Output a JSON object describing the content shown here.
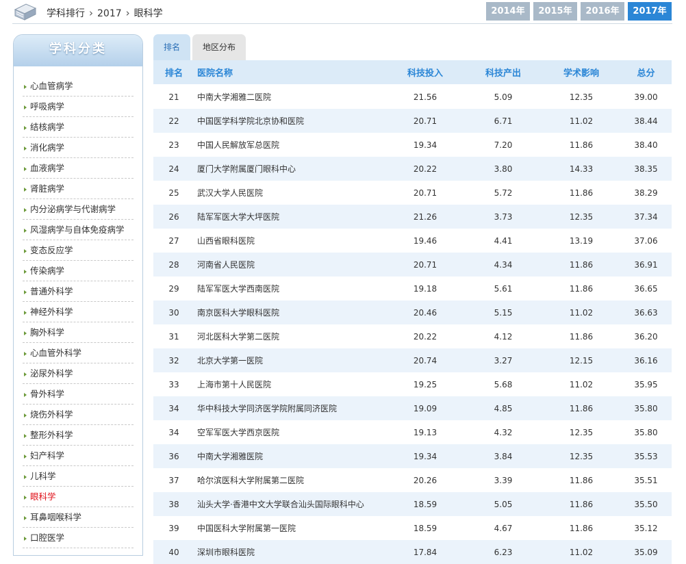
{
  "header": {
    "breadcrumb": [
      "学科排行",
      "2017",
      "眼科学"
    ],
    "years": [
      "2014年",
      "2015年",
      "2016年",
      "2017年"
    ],
    "active_year": "2017年"
  },
  "sidebar": {
    "title": "学科分类",
    "items": [
      "心血管病学",
      "呼吸病学",
      "结核病学",
      "消化病学",
      "血液病学",
      "肾脏病学",
      "内分泌病学与代谢病学",
      "风湿病学与自体免疫病学",
      "变态反应学",
      "传染病学",
      "普通外科学",
      "神经外科学",
      "胸外科学",
      "心血管外科学",
      "泌尿外科学",
      "骨外科学",
      "烧伤外科学",
      "整形外科学",
      "妇产科学",
      "儿科学",
      "眼科学",
      "耳鼻咽喉科学",
      "口腔医学"
    ],
    "active": "眼科学"
  },
  "tabs": [
    "排名",
    "地区分布"
  ],
  "table": {
    "columns": [
      "排名",
      "医院名称",
      "科技投入",
      "科技产出",
      "学术影响",
      "总分"
    ],
    "rows": [
      [
        "21",
        "中南大学湘雅二医院",
        "21.56",
        "5.09",
        "12.35",
        "39.00"
      ],
      [
        "22",
        "中国医学科学院北京协和医院",
        "20.71",
        "6.71",
        "11.02",
        "38.44"
      ],
      [
        "23",
        "中国人民解放军总医院",
        "19.34",
        "7.20",
        "11.86",
        "38.40"
      ],
      [
        "24",
        "厦门大学附属厦门眼科中心",
        "20.22",
        "3.80",
        "14.33",
        "38.35"
      ],
      [
        "25",
        "武汉大学人民医院",
        "20.71",
        "5.72",
        "11.86",
        "38.29"
      ],
      [
        "26",
        "陆军军医大学大坪医院",
        "21.26",
        "3.73",
        "12.35",
        "37.34"
      ],
      [
        "27",
        "山西省眼科医院",
        "19.46",
        "4.41",
        "13.19",
        "37.06"
      ],
      [
        "28",
        "河南省人民医院",
        "20.71",
        "4.34",
        "11.86",
        "36.91"
      ],
      [
        "29",
        "陆军军医大学西南医院",
        "19.18",
        "5.61",
        "11.86",
        "36.65"
      ],
      [
        "30",
        "南京医科大学眼科医院",
        "20.46",
        "5.15",
        "11.02",
        "36.63"
      ],
      [
        "31",
        "河北医科大学第二医院",
        "20.22",
        "4.12",
        "11.86",
        "36.20"
      ],
      [
        "32",
        "北京大学第一医院",
        "20.74",
        "3.27",
        "12.15",
        "36.16"
      ],
      [
        "33",
        "上海市第十人民医院",
        "19.25",
        "5.68",
        "11.02",
        "35.95"
      ],
      [
        "34",
        "华中科技大学同济医学院附属同济医院",
        "19.09",
        "4.85",
        "11.86",
        "35.80"
      ],
      [
        "34",
        "空军军医大学西京医院",
        "19.13",
        "4.32",
        "12.35",
        "35.80"
      ],
      [
        "36",
        "中南大学湘雅医院",
        "19.34",
        "3.84",
        "12.35",
        "35.53"
      ],
      [
        "37",
        "哈尔滨医科大学附属第二医院",
        "20.26",
        "3.39",
        "11.86",
        "35.51"
      ],
      [
        "38",
        "汕头大学·香港中文大学联合汕头国际眼科中心",
        "18.59",
        "5.05",
        "11.86",
        "35.50"
      ],
      [
        "39",
        "中国医科大学附属第一医院",
        "18.59",
        "4.67",
        "11.86",
        "35.12"
      ],
      [
        "40",
        "深圳市眼科医院",
        "17.84",
        "6.23",
        "11.02",
        "35.09"
      ]
    ]
  },
  "colors": {
    "accent": "#2b86d6",
    "active_item": "#e0121b",
    "row_alt": "#ebf3fb"
  }
}
